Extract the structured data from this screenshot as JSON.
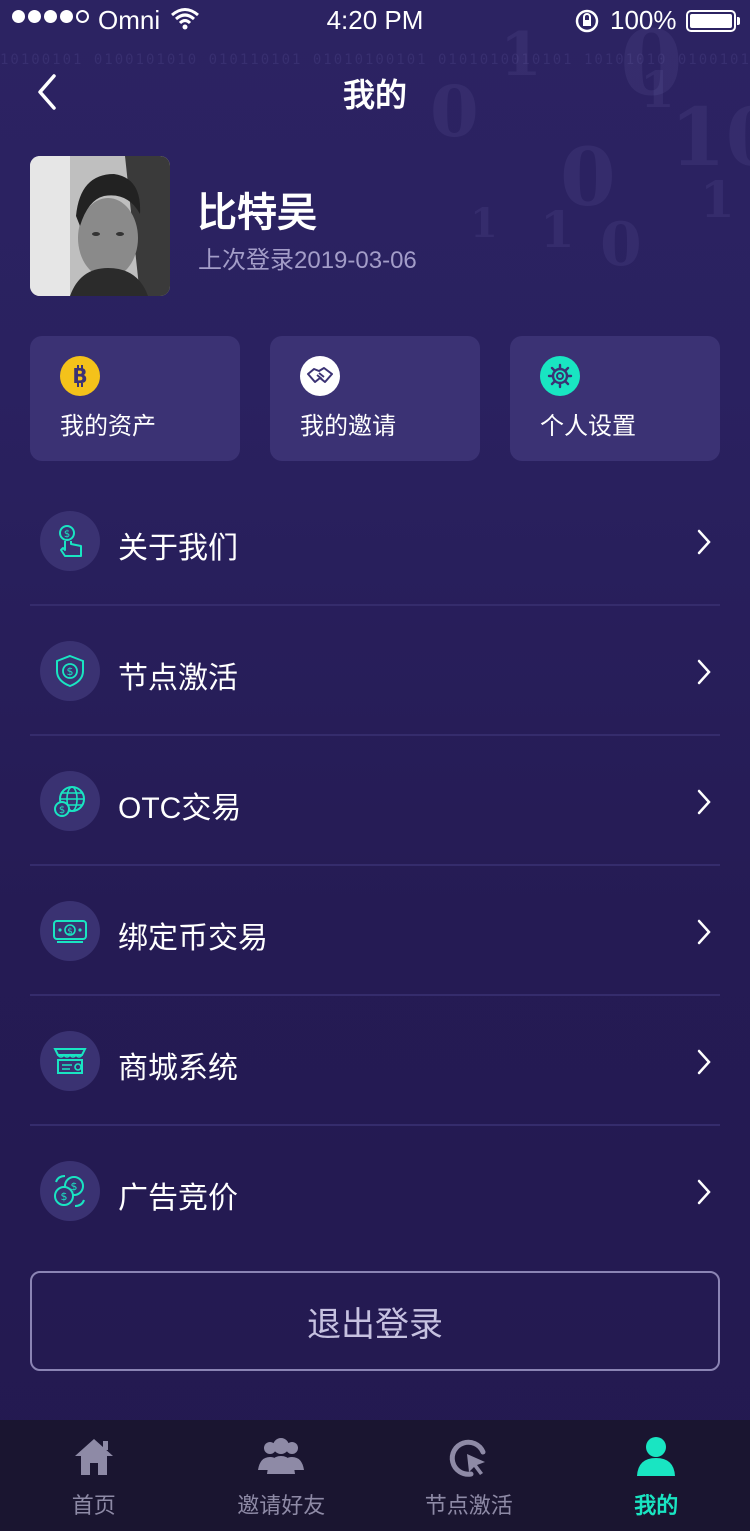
{
  "status_bar": {
    "carrier": "Omni",
    "time": "4:20 PM",
    "battery_pct": "100%"
  },
  "nav": {
    "title": "我的"
  },
  "profile": {
    "name": "比特吴",
    "last_login": "上次登录2019-03-06"
  },
  "quick_cards": [
    {
      "label": "我的资产",
      "icon": "bitcoin-icon",
      "color": "#f4c21a"
    },
    {
      "label": "我的邀请",
      "icon": "handshake-icon",
      "color": "#ffffff"
    },
    {
      "label": "个人设置",
      "icon": "gear-icon",
      "color": "#19e5c2"
    }
  ],
  "menu": [
    {
      "label": "关于我们",
      "icon": "hand-coin-icon"
    },
    {
      "label": "节点激活",
      "icon": "shield-dollar-icon"
    },
    {
      "label": "OTC交易",
      "icon": "globe-dollar-icon"
    },
    {
      "label": "绑定币交易",
      "icon": "cash-icon"
    },
    {
      "label": "商城系统",
      "icon": "store-icon"
    },
    {
      "label": "广告竞价",
      "icon": "coin-exchange-icon"
    }
  ],
  "logout_label": "退出登录",
  "tabs": [
    {
      "label": "首页",
      "icon": "home-icon",
      "active": false
    },
    {
      "label": "邀请好友",
      "icon": "people-icon",
      "active": false
    },
    {
      "label": "节点激活",
      "icon": "node-cursor-icon",
      "active": false
    },
    {
      "label": "我的",
      "icon": "person-icon",
      "active": true
    }
  ],
  "colors": {
    "accent": "#19e5c2",
    "card_bg": "#3b3274",
    "tab_inactive": "#8e8aa6"
  }
}
